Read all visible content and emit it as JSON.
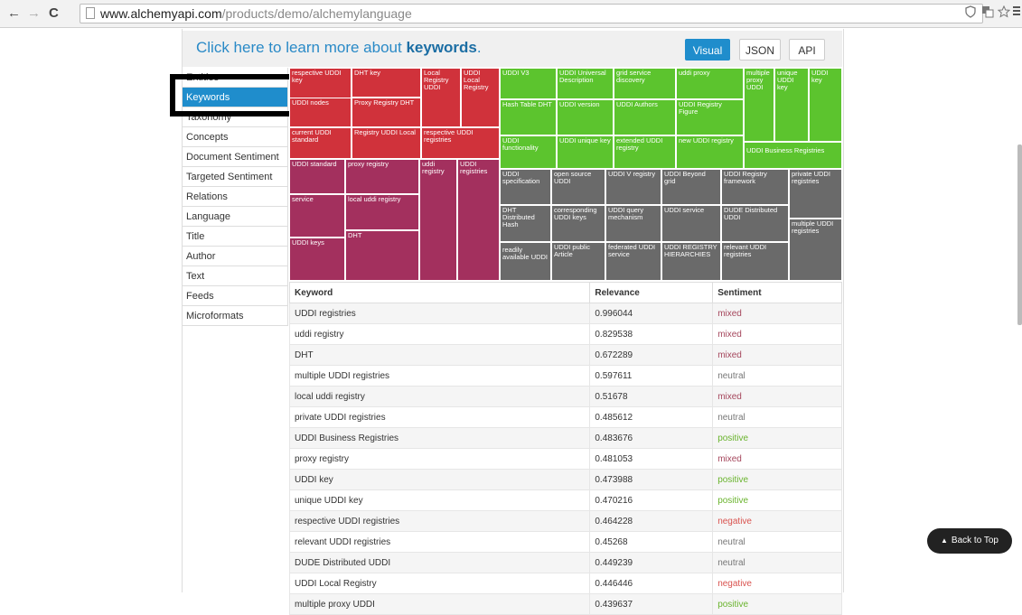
{
  "browser": {
    "back_glyph": "←",
    "forward_glyph": "→",
    "reload_glyph": "C",
    "url_host": "www.alchemyapi.com",
    "url_path": "/products/demo/alchemylanguage",
    "icons": [
      "shield-icon",
      "translate-icon",
      "star-icon",
      "menu-icon"
    ]
  },
  "header": {
    "learn_prefix": "Click here to learn more about ",
    "learn_strong": "keywords",
    "learn_suffix": ".",
    "tabs": [
      "Visual",
      "JSON",
      "API"
    ],
    "active_tab": "Visual"
  },
  "sidebar": {
    "items": [
      "Entities",
      "Keywords",
      "Taxonomy",
      "Concepts",
      "Document Sentiment",
      "Targeted Sentiment",
      "Relations",
      "Language",
      "Title",
      "Author",
      "Text",
      "Feeds",
      "Microformats"
    ],
    "active": "Keywords"
  },
  "treemap": {
    "colors": {
      "red": "#d0323b",
      "mag": "#a3305e",
      "grn": "#5cc42e",
      "gry": "#6a6a6a"
    },
    "tiles": [
      {
        "label": "respective UDDI key",
        "c": "red"
      },
      {
        "label": "DHT key",
        "c": "red"
      },
      {
        "label": "Local Registry UDDI",
        "c": "red"
      },
      {
        "label": "UDDI Local Registry",
        "c": "red"
      },
      {
        "label": "UDDI nodes",
        "c": "red"
      },
      {
        "label": "Proxy Registry DHT",
        "c": "red"
      },
      {
        "label": "current UDDI standard",
        "c": "red"
      },
      {
        "label": "Registry UDDI Local",
        "c": "red"
      },
      {
        "label": "respective UDDI registries",
        "c": "red"
      },
      {
        "label": "UDDI standard",
        "c": "mag"
      },
      {
        "label": "proxy registry",
        "c": "mag"
      },
      {
        "label": "uddi registry",
        "c": "mag"
      },
      {
        "label": "UDDI registries",
        "c": "mag"
      },
      {
        "label": "local uddi registry",
        "c": "mag"
      },
      {
        "label": "service",
        "c": "mag"
      },
      {
        "label": "DHT",
        "c": "mag"
      },
      {
        "label": "UDDI keys",
        "c": "mag"
      },
      {
        "label": "UDDI V3",
        "c": "grn"
      },
      {
        "label": "UDDI Universal Description",
        "c": "grn"
      },
      {
        "label": "grid service discovery",
        "c": "grn"
      },
      {
        "label": "uddi proxy",
        "c": "grn"
      },
      {
        "label": "multiple proxy UDDI",
        "c": "grn"
      },
      {
        "label": "unique UDDI key",
        "c": "grn"
      },
      {
        "label": "UDDI key",
        "c": "grn"
      },
      {
        "label": "Hash Table DHT",
        "c": "grn"
      },
      {
        "label": "UDDI version",
        "c": "grn"
      },
      {
        "label": "UDDI Authors",
        "c": "grn"
      },
      {
        "label": "UDDI Registry Figure",
        "c": "grn"
      },
      {
        "label": "UDDI functionality",
        "c": "grn"
      },
      {
        "label": "UDDI unique key",
        "c": "grn"
      },
      {
        "label": "extended UDDI registry",
        "c": "grn"
      },
      {
        "label": "new UDDI registry",
        "c": "grn"
      },
      {
        "label": "UDDI Business Registries",
        "c": "grn"
      },
      {
        "label": "UDDI specification",
        "c": "gry"
      },
      {
        "label": "open source UDDI",
        "c": "gry"
      },
      {
        "label": "UDDI V registry",
        "c": "gry"
      },
      {
        "label": "UDDI Beyond grid",
        "c": "gry"
      },
      {
        "label": "UDDI Registry framework",
        "c": "gry"
      },
      {
        "label": "private UDDI registries",
        "c": "gry"
      },
      {
        "label": "DHT Distributed Hash",
        "c": "gry"
      },
      {
        "label": "corresponding UDDI keys",
        "c": "gry"
      },
      {
        "label": "UDDI query mechanism",
        "c": "gry"
      },
      {
        "label": "UDDI service",
        "c": "gry"
      },
      {
        "label": "DUDE Distributed UDDI",
        "c": "gry"
      },
      {
        "label": "multiple UDDI registries",
        "c": "gry"
      },
      {
        "label": "readily available UDDI",
        "c": "gry"
      },
      {
        "label": "UDDI public Article",
        "c": "gry"
      },
      {
        "label": "federated UDDI service",
        "c": "gry"
      },
      {
        "label": "UDDI REGISTRY HIERARCHIES",
        "c": "gry"
      },
      {
        "label": "relevant UDDI registries",
        "c": "gry"
      }
    ]
  },
  "table": {
    "headers": [
      "Keyword",
      "Relevance",
      "Sentiment"
    ],
    "rows": [
      [
        "UDDI registries",
        "0.996044",
        "mixed"
      ],
      [
        "uddi registry",
        "0.829538",
        "mixed"
      ],
      [
        "DHT",
        "0.672289",
        "mixed"
      ],
      [
        "multiple UDDI registries",
        "0.597611",
        "neutral"
      ],
      [
        "local uddi registry",
        "0.51678",
        "mixed"
      ],
      [
        "private UDDI registries",
        "0.485612",
        "neutral"
      ],
      [
        "UDDI Business Registries",
        "0.483676",
        "positive"
      ],
      [
        "proxy registry",
        "0.481053",
        "mixed"
      ],
      [
        "UDDI key",
        "0.473988",
        "positive"
      ],
      [
        "unique UDDI key",
        "0.470216",
        "positive"
      ],
      [
        "respective UDDI registries",
        "0.464228",
        "negative"
      ],
      [
        "relevant UDDI registries",
        "0.45268",
        "neutral"
      ],
      [
        "DUDE Distributed UDDI",
        "0.449239",
        "neutral"
      ],
      [
        "UDDI Local Registry",
        "0.446446",
        "negative"
      ],
      [
        "multiple proxy UDDI",
        "0.439637",
        "positive"
      ]
    ]
  },
  "back_to_top": {
    "glyph": "▲",
    "label": "Back to Top"
  }
}
